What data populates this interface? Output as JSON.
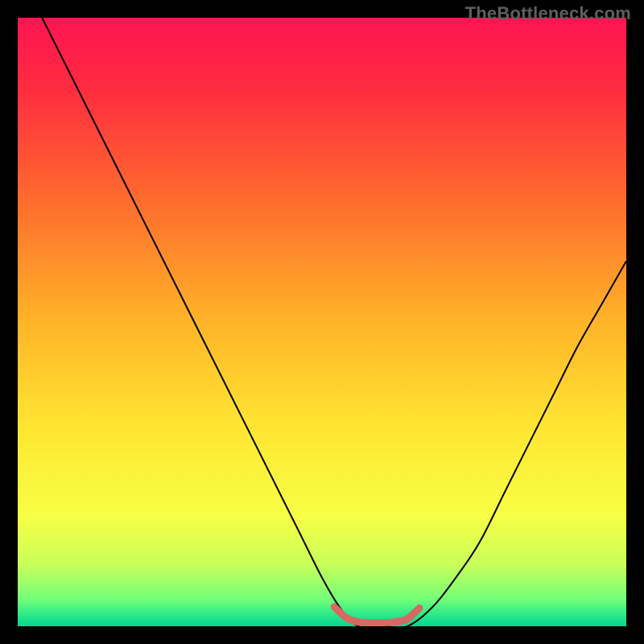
{
  "watermark": {
    "text": "TheBottleneck.com"
  },
  "chart_data": {
    "type": "line",
    "title": "",
    "xlabel": "",
    "ylabel": "",
    "xlim": [
      0,
      100
    ],
    "ylim": [
      0,
      100
    ],
    "gradient_stops": [
      {
        "offset": 0.0,
        "color": "#ff1452"
      },
      {
        "offset": 0.12,
        "color": "#ff2d3f"
      },
      {
        "offset": 0.3,
        "color": "#ff6b2e"
      },
      {
        "offset": 0.5,
        "color": "#ffb428"
      },
      {
        "offset": 0.68,
        "color": "#ffe733"
      },
      {
        "offset": 0.82,
        "color": "#f7ff44"
      },
      {
        "offset": 0.9,
        "color": "#c7ff5a"
      },
      {
        "offset": 0.955,
        "color": "#74ff78"
      },
      {
        "offset": 0.985,
        "color": "#22e58b"
      },
      {
        "offset": 1.0,
        "color": "#00d88f"
      }
    ],
    "series": [
      {
        "name": "bottleneck-curve",
        "color": "#000000",
        "width": 2,
        "x": [
          4,
          10,
          16,
          22,
          28,
          34,
          40,
          46,
          50,
          53,
          56,
          60,
          64,
          68,
          72,
          76,
          80,
          84,
          88,
          92,
          96,
          100
        ],
        "y": [
          100,
          88,
          76,
          64,
          52,
          40,
          28,
          16,
          8,
          3,
          0,
          0,
          0,
          3,
          8,
          14,
          22,
          30,
          38,
          46,
          53,
          60
        ]
      },
      {
        "name": "optimal-zone-marker",
        "color": "#d46a63",
        "width": 9,
        "caps": "round",
        "x": [
          52,
          54,
          56,
          58,
          60,
          62,
          64,
          66
        ],
        "y": [
          3.2,
          1.4,
          0.7,
          0.6,
          0.6,
          0.7,
          1.2,
          3.0
        ]
      }
    ],
    "annotations": []
  }
}
